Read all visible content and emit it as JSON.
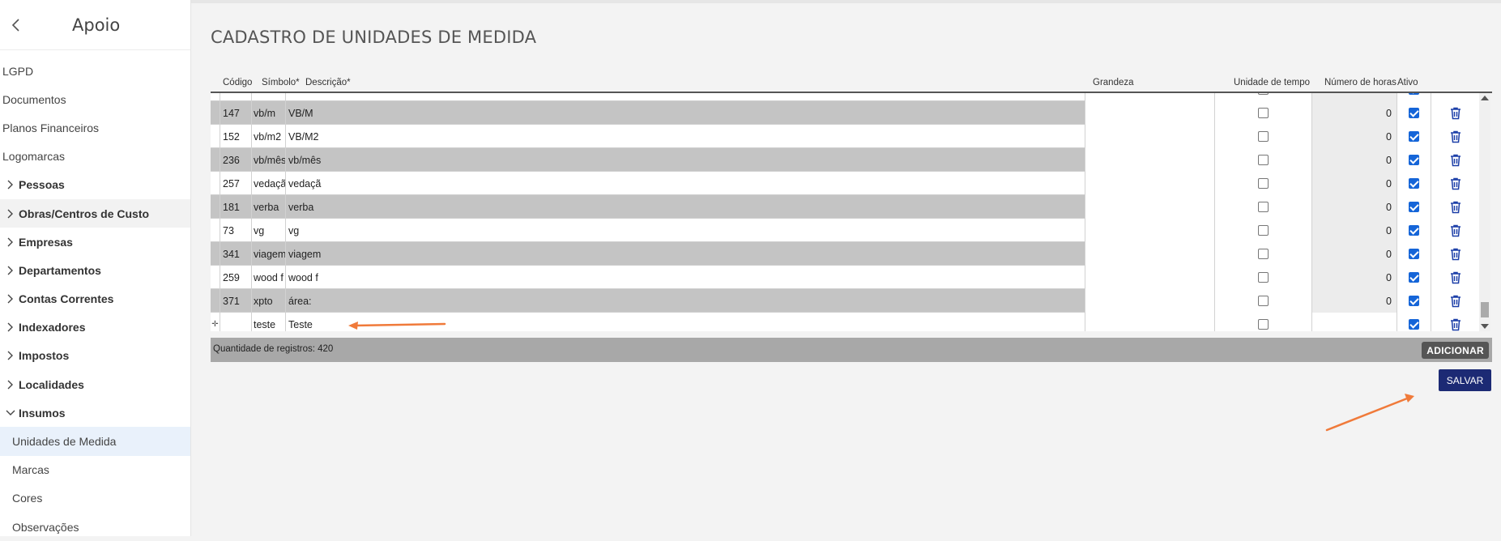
{
  "sidebar": {
    "title": "Apoio",
    "items": [
      {
        "label": "LGPD"
      },
      {
        "label": "Documentos"
      },
      {
        "label": "Planos Financeiros"
      },
      {
        "label": "Logomarcas"
      },
      {
        "label": "Pessoas"
      },
      {
        "label": "Obras/Centros de Custo"
      },
      {
        "label": "Empresas"
      },
      {
        "label": "Departamentos"
      },
      {
        "label": "Contas Correntes"
      },
      {
        "label": "Indexadores"
      },
      {
        "label": "Impostos"
      },
      {
        "label": "Localidades"
      },
      {
        "label": "Insumos"
      },
      {
        "label": "Unidades de Medida"
      },
      {
        "label": "Marcas"
      },
      {
        "label": "Cores"
      },
      {
        "label": "Observações"
      }
    ]
  },
  "page": {
    "title": "CADASTRO DE UNIDADES DE MEDIDA"
  },
  "grid": {
    "columns": {
      "codigo": "Código",
      "simbolo": "Símbolo*",
      "descricao": "Descrição*",
      "grandeza": "Grandeza",
      "unidade_tempo": "Unidade de tempo",
      "numero_horas": "Número de horas",
      "ativo": "Ativo"
    },
    "rows": [
      {
        "codigo": "147",
        "simbolo": "vb/m",
        "descricao": "VB/M",
        "grandeza": "",
        "unidade_tempo": false,
        "horas": "0",
        "ativo": true
      },
      {
        "codigo": "152",
        "simbolo": "vb/m2",
        "descricao": "VB/M2",
        "grandeza": "",
        "unidade_tempo": false,
        "horas": "0",
        "ativo": true
      },
      {
        "codigo": "236",
        "simbolo": "vb/mês",
        "descricao": "vb/mês",
        "grandeza": "",
        "unidade_tempo": false,
        "horas": "0",
        "ativo": true
      },
      {
        "codigo": "257",
        "simbolo": "vedaçã",
        "descricao": "vedaçã",
        "grandeza": "",
        "unidade_tempo": false,
        "horas": "0",
        "ativo": true
      },
      {
        "codigo": "181",
        "simbolo": "verba",
        "descricao": "verba",
        "grandeza": "",
        "unidade_tempo": false,
        "horas": "0",
        "ativo": true
      },
      {
        "codigo": "73",
        "simbolo": "vg",
        "descricao": "vg",
        "grandeza": "",
        "unidade_tempo": false,
        "horas": "0",
        "ativo": true
      },
      {
        "codigo": "341",
        "simbolo": "viagem",
        "descricao": "viagem",
        "grandeza": "",
        "unidade_tempo": false,
        "horas": "0",
        "ativo": true
      },
      {
        "codigo": "259",
        "simbolo": "wood f",
        "descricao": "wood f",
        "grandeza": "",
        "unidade_tempo": false,
        "horas": "0",
        "ativo": true
      },
      {
        "codigo": "371",
        "simbolo": "xpto",
        "descricao": "área:",
        "grandeza": "",
        "unidade_tempo": false,
        "horas": "0",
        "ativo": true
      },
      {
        "codigo": "",
        "simbolo": "teste",
        "descricao": "Teste",
        "grandeza": "",
        "unidade_tempo": false,
        "horas": "",
        "ativo": true,
        "is_new": true
      }
    ],
    "footer": {
      "count_label": "Quantidade de registros: 420",
      "add_label": "ADICIONAR"
    }
  },
  "actions": {
    "save_label": "SALVAR"
  },
  "colors": {
    "accent_save": "#1c2a74",
    "checkbox_blue": "#1565d8",
    "trash_blue": "#1c3fa8",
    "annotation_arrow": "#f07a3a",
    "row_alt": "#c4c4c4"
  },
  "icons": {
    "back": "chevron-left-icon",
    "group": "chevron-right-icon",
    "group_open": "chevron-down-icon",
    "delete": "trash-icon",
    "new_row": "row-marker-icon"
  }
}
